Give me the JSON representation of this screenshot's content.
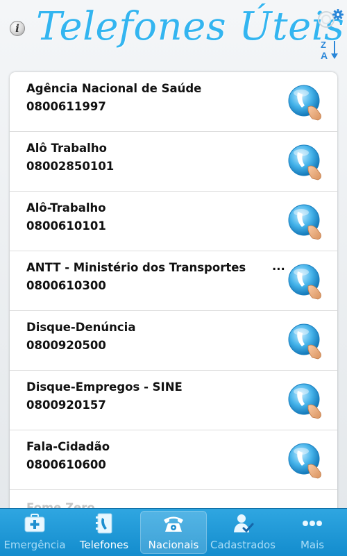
{
  "header": {
    "title": "Telefones Úteis",
    "info_icon": "info-icon",
    "settings_icon": "gear-icon",
    "sort_icon": "sort-z-a-icon",
    "title_color": "#33b5f0"
  },
  "contacts": [
    {
      "name": "Agência Nacional de Saúde",
      "number": "0800611997"
    },
    {
      "name": "Alô Trabalho",
      "number": "08002850101"
    },
    {
      "name": "Alô-Trabalho",
      "number": "0800610101"
    },
    {
      "name": "ANTT - Ministério dos Transportes",
      "ellipsis": "...",
      "number": "0800610300"
    },
    {
      "name": "Disque-Denúncia",
      "number": "0800920500"
    },
    {
      "name": "Disque-Empregos - SINE",
      "number": "0800920157"
    },
    {
      "name": "Fala-Cidadão",
      "number": "0800610600"
    },
    {
      "name": "Fome Zero"
    }
  ],
  "call_icon": "phone-call-icon",
  "tabs": [
    {
      "label": "Emergência",
      "icon": "first-aid-kit-icon"
    },
    {
      "label": "Telefones",
      "icon": "phone-book-icon"
    },
    {
      "label": "Nacionais",
      "icon": "telephone-icon",
      "selected": true
    },
    {
      "label": "Cadastrados",
      "icon": "user-check-icon"
    },
    {
      "label": "Mais",
      "icon": "more-dots-icon"
    }
  ],
  "colors": {
    "tab_bar": "#1e9ad8",
    "accent": "#33b5f0",
    "tab_label_dim": "#a9dcf6"
  }
}
